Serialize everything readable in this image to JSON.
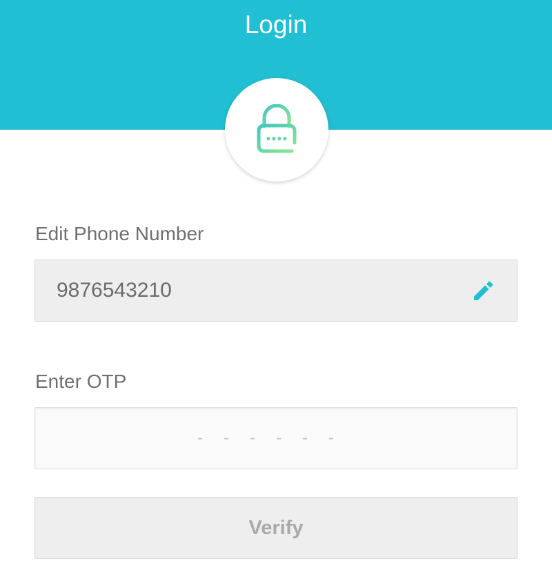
{
  "header": {
    "title": "Login",
    "background_color": "#21bfd3"
  },
  "badge": {
    "icon": "lock-icon",
    "icon_gradient": [
      "#3ec7c4",
      "#8ee38e"
    ]
  },
  "phone": {
    "label": "Edit Phone Number",
    "value": "9876543210",
    "edit_icon": "pencil-icon",
    "edit_icon_color": "#21bfd3"
  },
  "otp": {
    "label": "Enter OTP",
    "placeholder": "------"
  },
  "verify": {
    "label": "Verify"
  }
}
